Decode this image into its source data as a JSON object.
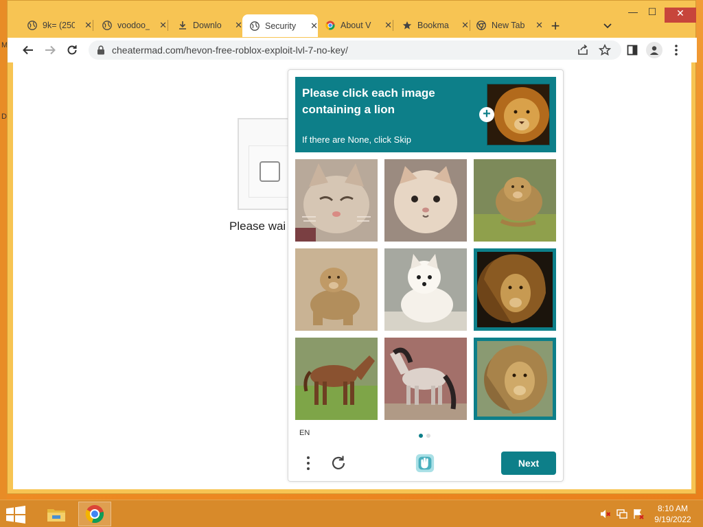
{
  "desktop": {
    "edge_marks": [
      "M",
      "D"
    ]
  },
  "tabs": [
    {
      "title": "9k= (250",
      "icon": "globe-icon",
      "active": false
    },
    {
      "title": "voodoo_",
      "icon": "globe-icon",
      "active": false
    },
    {
      "title": "Downlo",
      "icon": "download-icon",
      "active": false
    },
    {
      "title": "Security",
      "icon": "globe-icon",
      "active": true
    },
    {
      "title": "About V",
      "icon": "chrome-icon",
      "active": false
    },
    {
      "title": "Bookma",
      "icon": "star-icon",
      "active": false
    },
    {
      "title": "New Tab",
      "icon": "chrome-icon",
      "active": false
    }
  ],
  "tab_close_glyph": "✕",
  "new_tab_glyph": "+",
  "window_controls": {
    "minimize": "—",
    "maximize": "☐",
    "close": "✕"
  },
  "address_bar": {
    "url": "cheatermad.com/hevon-free-roblox-exploit-lvl-7-no-key/"
  },
  "page": {
    "wait_text": "Please wai"
  },
  "challenge": {
    "prompt_line": "Please click each image containing a lion",
    "hint": "If there are None, click Skip",
    "tiles": [
      {
        "subject": "cat",
        "selected": false
      },
      {
        "subject": "cat",
        "selected": false
      },
      {
        "subject": "lion",
        "selected": false
      },
      {
        "subject": "lion",
        "selected": false
      },
      {
        "subject": "dog",
        "selected": false
      },
      {
        "subject": "lion",
        "selected": true
      },
      {
        "subject": "horse",
        "selected": false
      },
      {
        "subject": "horse",
        "selected": false
      },
      {
        "subject": "lion",
        "selected": true
      }
    ],
    "language": "EN",
    "next_label": "Next",
    "accent_color": "#0d7f89"
  },
  "taskbar": {
    "time": "8:10 AM",
    "date": "9/19/2022",
    "apps": [
      "file-explorer-icon",
      "chrome-icon"
    ]
  }
}
